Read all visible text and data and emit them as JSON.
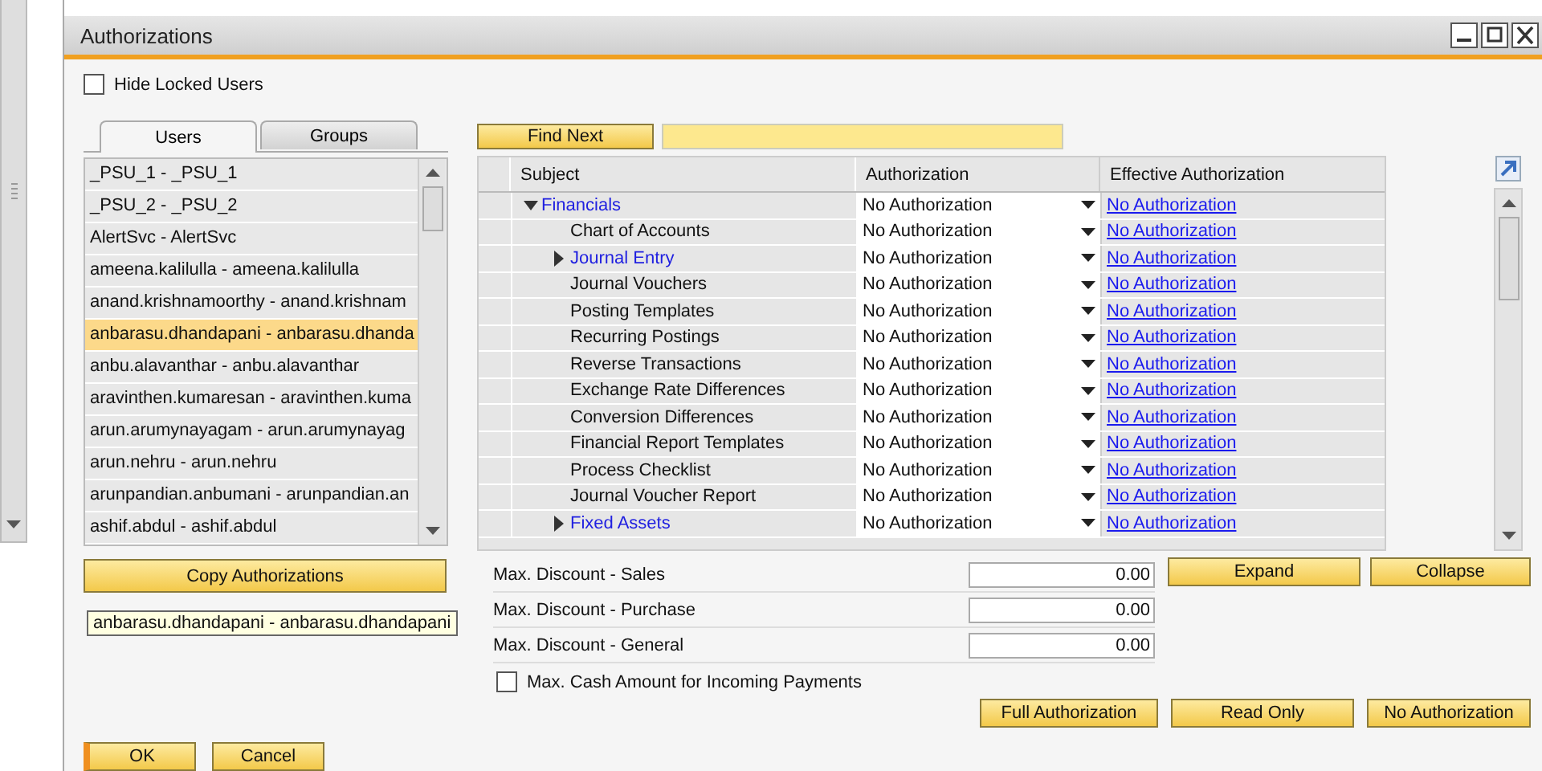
{
  "window": {
    "title": "Authorizations"
  },
  "hide_locked": {
    "label": "Hide Locked Users",
    "checked": false
  },
  "tabs": [
    {
      "label": "Users",
      "selected": true
    },
    {
      "label": "Groups",
      "selected": false
    }
  ],
  "users": [
    {
      "text": "_PSU_1 - _PSU_1",
      "selected": false
    },
    {
      "text": "_PSU_2 - _PSU_2",
      "selected": false
    },
    {
      "text": "AlertSvc - AlertSvc",
      "selected": false
    },
    {
      "text": "ameena.kalilulla - ameena.kalilulla",
      "selected": false
    },
    {
      "text": "anand.krishnamoorthy - anand.krishnam",
      "selected": false
    },
    {
      "text": "anbarasu.dhandapani - anbarasu.dhanda",
      "selected": true
    },
    {
      "text": "anbu.alavanthar - anbu.alavanthar",
      "selected": false
    },
    {
      "text": "aravinthen.kumaresan - aravinthen.kuma",
      "selected": false
    },
    {
      "text": "arun.arumynayagam - arun.arumynayag",
      "selected": false
    },
    {
      "text": "arun.nehru - arun.nehru",
      "selected": false
    },
    {
      "text": "arunpandian.anbumani - arunpandian.an",
      "selected": false
    },
    {
      "text": "ashif.abdul - ashif.abdul",
      "selected": false
    }
  ],
  "tooltip": "anbarasu.dhandapani - anbarasu.dhandapani",
  "find_button": "Find Next",
  "grid": {
    "columns": [
      "Subject",
      "Authorization",
      "Effective Authorization"
    ],
    "rows": [
      {
        "subject": "Financials",
        "expanded": true,
        "authorization": "No Authorization",
        "effective": "No Authorization",
        "children": [
          {
            "subject": "Chart of Accounts",
            "authorization": "No Authorization",
            "effective": "No Authorization"
          },
          {
            "subject": "Journal Entry",
            "expanded": false,
            "authorization": "No Authorization",
            "effective": "No Authorization"
          },
          {
            "subject": "Journal Vouchers",
            "authorization": "No Authorization",
            "effective": "No Authorization"
          },
          {
            "subject": "Posting Templates",
            "authorization": "No Authorization",
            "effective": "No Authorization"
          },
          {
            "subject": "Recurring Postings",
            "authorization": "No Authorization",
            "effective": "No Authorization"
          },
          {
            "subject": "Reverse Transactions",
            "authorization": "No Authorization",
            "effective": "No Authorization"
          },
          {
            "subject": "Exchange Rate Differences",
            "authorization": "No Authorization",
            "effective": "No Authorization"
          },
          {
            "subject": "Conversion Differences",
            "authorization": "No Authorization",
            "effective": "No Authorization"
          },
          {
            "subject": "Financial Report Templates",
            "authorization": "No Authorization",
            "effective": "No Authorization"
          },
          {
            "subject": "Process Checklist",
            "authorization": "No Authorization",
            "effective": "No Authorization"
          },
          {
            "subject": "Journal Voucher Report",
            "authorization": "No Authorization",
            "effective": "No Authorization"
          },
          {
            "subject": "Fixed Assets",
            "expanded": false,
            "authorization": "No Authorization",
            "effective": "No Authorization"
          }
        ]
      }
    ]
  },
  "discounts": [
    {
      "label": "Max. Discount - Sales",
      "value": "0.00"
    },
    {
      "label": "Max. Discount - Purchase",
      "value": "0.00"
    },
    {
      "label": "Max. Discount - General",
      "value": "0.00"
    }
  ],
  "max_cash": {
    "label": "Max. Cash Amount for Incoming Payments",
    "checked": false
  },
  "copy_button": "Copy Authorizations",
  "expand_buttons": [
    "Expand",
    "Collapse"
  ],
  "preset_buttons": [
    "Full Authorization",
    "Read Only",
    "No Authorization"
  ],
  "dialog_buttons": [
    "OK",
    "Cancel"
  ]
}
